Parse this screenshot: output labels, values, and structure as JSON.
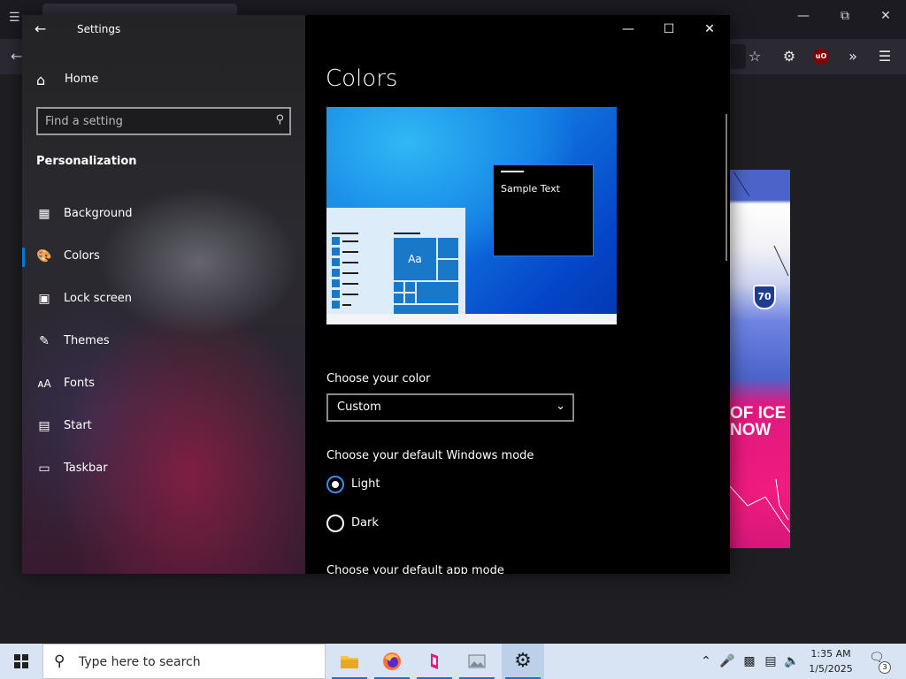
{
  "settings": {
    "app_title": "Settings",
    "home_label": "Home",
    "search_placeholder": "Find a setting",
    "section_title": "Personalization",
    "nav_items": [
      {
        "label": "Background",
        "icon": "image-icon"
      },
      {
        "label": "Colors",
        "icon": "palette-icon"
      },
      {
        "label": "Lock screen",
        "icon": "lock-screen-icon"
      },
      {
        "label": "Themes",
        "icon": "brush-icon"
      },
      {
        "label": "Fonts",
        "icon": "font-icon"
      },
      {
        "label": "Start",
        "icon": "start-icon"
      },
      {
        "label": "Taskbar",
        "icon": "taskbar-icon"
      }
    ],
    "active_nav": "Colors",
    "page_title": "Colors",
    "preview": {
      "sample_text": "Sample Text",
      "tile_text": "Aa"
    },
    "choose_color_label": "Choose your color",
    "color_dropdown_value": "Custom",
    "windows_mode_label": "Choose your default Windows mode",
    "windows_mode_options": [
      "Light",
      "Dark"
    ],
    "windows_mode_selected": "Light",
    "app_mode_label": "Choose your default app mode"
  },
  "background_page": {
    "shield_number": "70",
    "headline": "OF ICE\nNOW"
  },
  "taskbar": {
    "search_placeholder": "Type here to search",
    "clock_time": "1:35 AM",
    "clock_date": "1/5/2025",
    "notification_count": "3"
  },
  "colors": {
    "accent": "#0078d7",
    "content_bg": "#000000",
    "taskbar_bg": "#d8e4f3"
  }
}
